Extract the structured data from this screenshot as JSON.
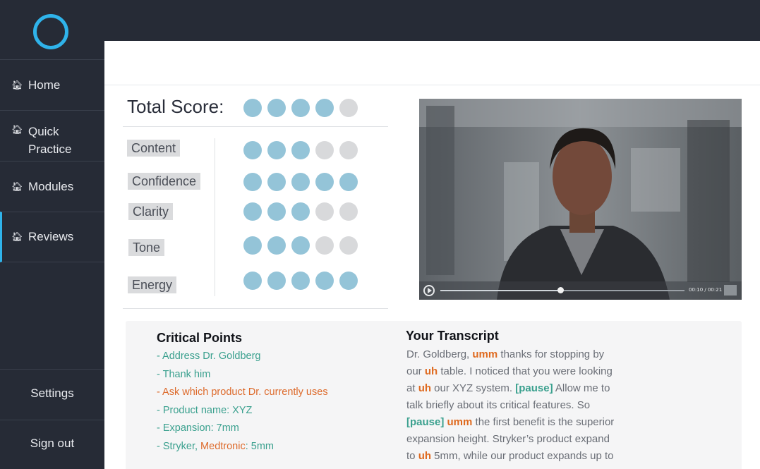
{
  "sidebar": {
    "logo": "ring-logo",
    "items": [
      {
        "label": "Home",
        "icon": "home-icon"
      },
      {
        "label": "Quick\nPractice",
        "icon": "home-icon"
      },
      {
        "label": "Modules",
        "icon": "home-icon"
      },
      {
        "label": "Reviews",
        "icon": "home-icon",
        "active": true
      }
    ],
    "settings_label": "Settings",
    "signout_label": "Sign out"
  },
  "scores": {
    "total_label": "Total Score:",
    "total_filled": 4,
    "total_max": 5,
    "categories": [
      {
        "label": "Content",
        "filled": 3,
        "max": 5
      },
      {
        "label": "Confidence",
        "filled": 5,
        "max": 5
      },
      {
        "label": "Clarity",
        "filled": 3,
        "max": 5
      },
      {
        "label": "Tone",
        "filled": 3,
        "max": 5
      },
      {
        "label": "Energy",
        "filled": 5,
        "max": 5
      }
    ]
  },
  "video": {
    "time": "00:10 / 00:21",
    "progress": 0.49
  },
  "critical_points": {
    "title": "Critical Points",
    "items": [
      {
        "text": "- Address Dr. Goldberg",
        "status": "met"
      },
      {
        "text": "- Thank him",
        "status": "met"
      },
      {
        "text": "- Ask which product Dr. currently uses",
        "status": "missed"
      },
      {
        "text": "- Product name: XYZ",
        "status": "met"
      },
      {
        "text": "- Expansion: 7mm",
        "status": "met"
      }
    ],
    "last_item": {
      "part1": "- Stryker, ",
      "part2": "Medtronic",
      "part3": ": 5mm"
    }
  },
  "transcript": {
    "title": "Your Transcript",
    "lines": [
      [
        {
          "t": "Dr. Goldberg, "
        },
        {
          "t": "umm",
          "k": "filler"
        },
        {
          "t": " thanks for stopping by"
        }
      ],
      [
        {
          "t": "our "
        },
        {
          "t": "uh",
          "k": "filler"
        },
        {
          "t": " table. I noticed that you were looking"
        }
      ],
      [
        {
          "t": "at "
        },
        {
          "t": "uh",
          "k": "filler"
        },
        {
          "t": " our XYZ system. "
        },
        {
          "t": "[pause]",
          "k": "pause"
        },
        {
          "t": " Allow me to"
        }
      ],
      [
        {
          "t": "talk briefly about its critical features. So"
        }
      ],
      [
        {
          "t": "[pause]",
          "k": "pause"
        },
        {
          "t": " "
        },
        {
          "t": "umm",
          "k": "filler"
        },
        {
          "t": " the first benefit is the superior"
        }
      ],
      [
        {
          "t": "expansion height. Stryker’s product expand"
        }
      ],
      [
        {
          "t": "to "
        },
        {
          "t": "uh",
          "k": "filler"
        },
        {
          "t": " 5mm, while our product expands up to"
        }
      ]
    ]
  },
  "colors": {
    "accent": "#2fb3ea",
    "dot_filled": "#94c4d8",
    "dot_empty": "#d8d9db",
    "met": "#3aa08e",
    "missed": "#dd6a2b"
  }
}
